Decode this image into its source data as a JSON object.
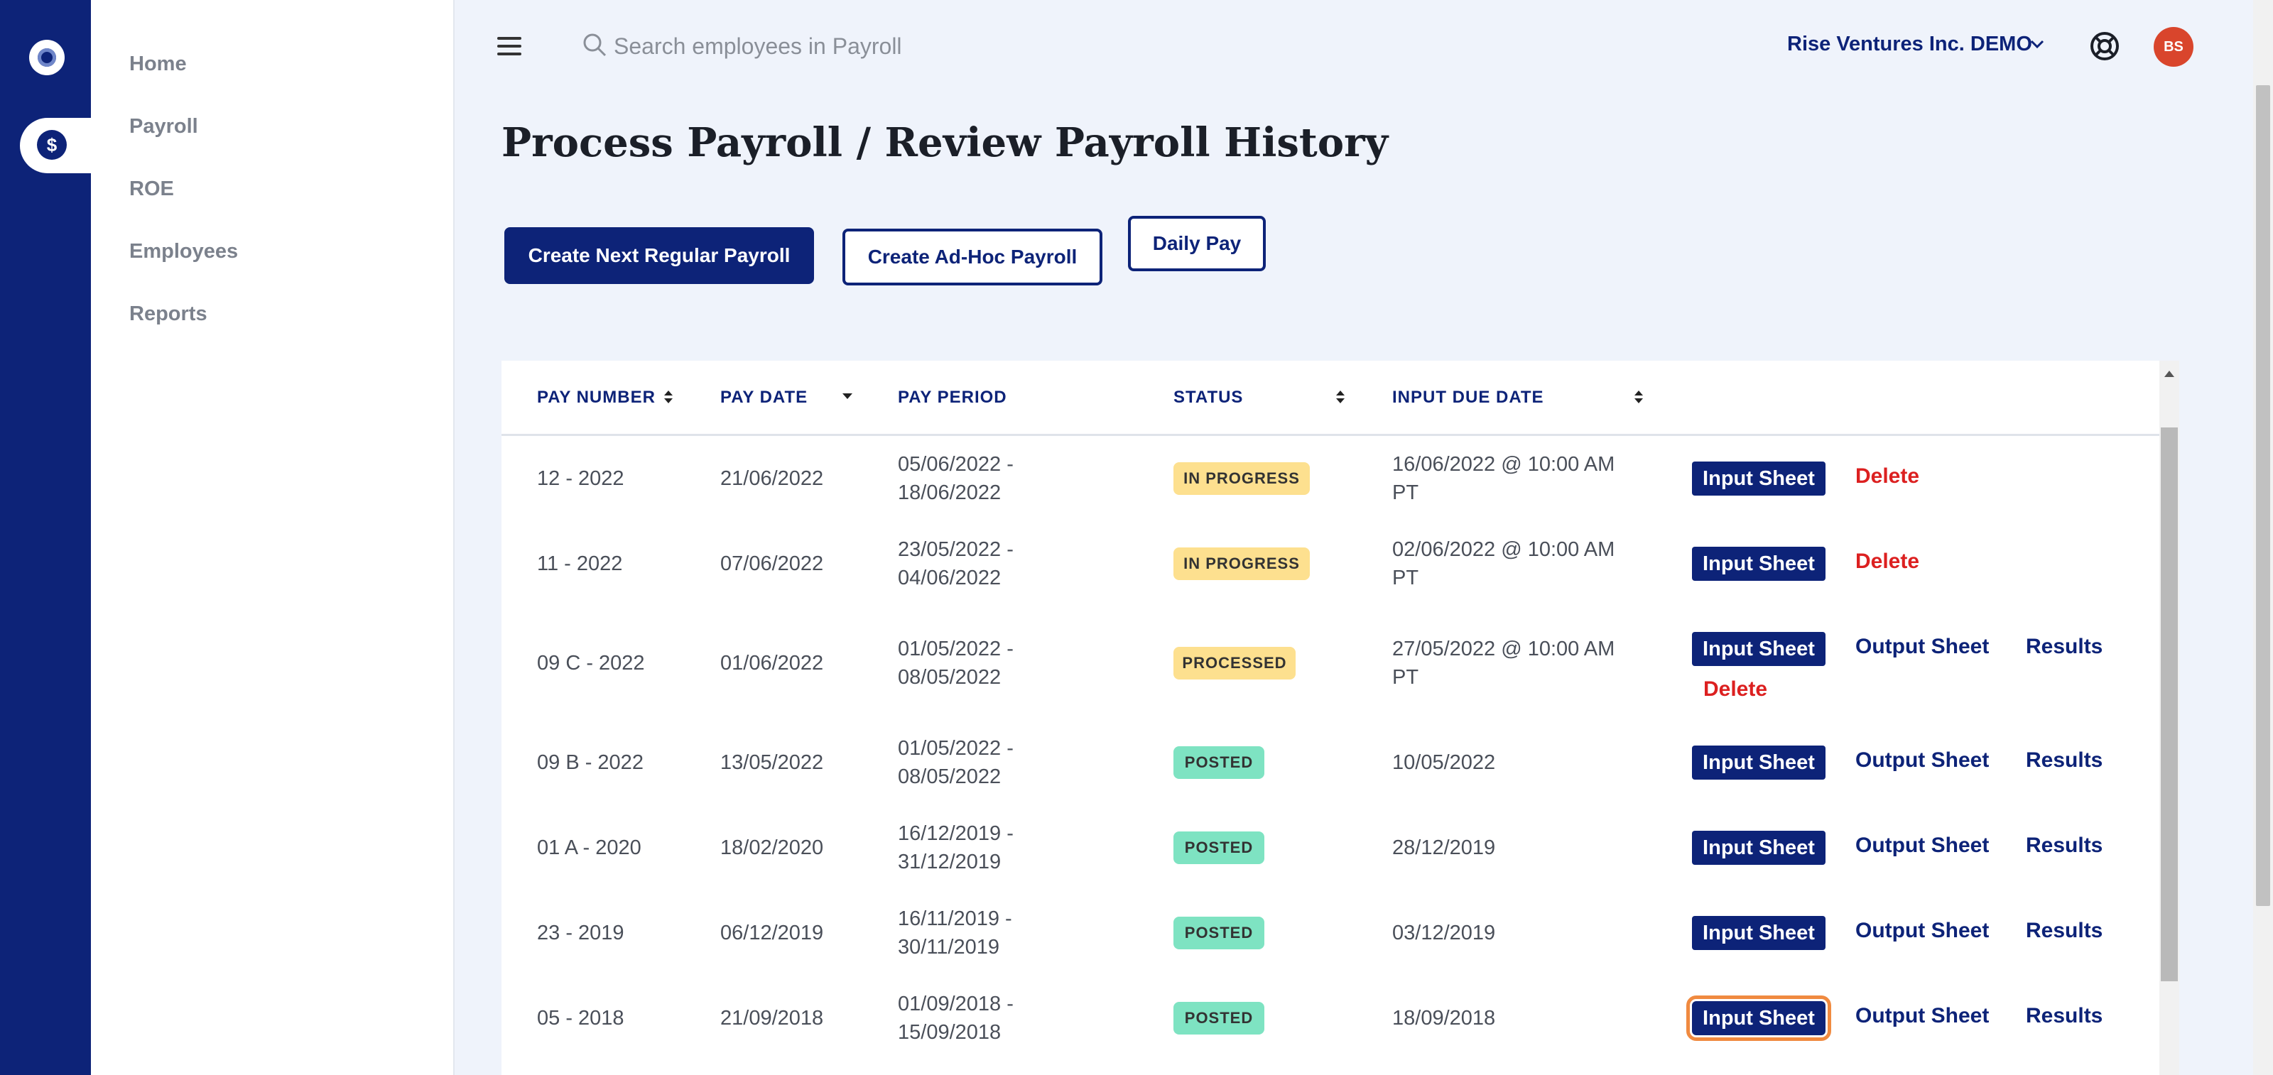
{
  "sidebar": {
    "items": [
      {
        "label": "Home"
      },
      {
        "label": "Payroll"
      },
      {
        "label": "ROE"
      },
      {
        "label": "Employees"
      },
      {
        "label": "Reports"
      }
    ]
  },
  "topbar": {
    "search_placeholder": "Search employees in Payroll",
    "company": "Rise Ventures Inc. DEMO",
    "avatar_initials": "BS"
  },
  "page": {
    "title": "Process Payroll / Review Payroll History",
    "buttons": {
      "create_regular": "Create Next Regular Payroll",
      "create_adhoc": "Create Ad-Hoc Payroll",
      "daily_pay": "Daily Pay"
    }
  },
  "table": {
    "headers": {
      "pay_number": "PAY NUMBER",
      "pay_date": "PAY DATE",
      "pay_period": "PAY PERIOD",
      "status": "STATUS",
      "input_due_date": "INPUT DUE DATE"
    },
    "actions": {
      "input_sheet": "Input Sheet",
      "output_sheet": "Output Sheet",
      "results": "Results",
      "delete": "Delete"
    },
    "rows": [
      {
        "pay_number": "12 - 2022",
        "pay_date": "21/06/2022",
        "period_start": "05/06/2022 -",
        "period_end": "18/06/2022",
        "status": "IN PROGRESS",
        "due_1": "16/06/2022 @ 10:00 AM",
        "due_2": "PT"
      },
      {
        "pay_number": "11 - 2022",
        "pay_date": "07/06/2022",
        "period_start": "23/05/2022 -",
        "period_end": "04/06/2022",
        "status": "IN PROGRESS",
        "due_1": "02/06/2022 @ 10:00 AM",
        "due_2": "PT"
      },
      {
        "pay_number": "09 C - 2022",
        "pay_date": "01/06/2022",
        "period_start": "01/05/2022 -",
        "period_end": "08/05/2022",
        "status": "PROCESSED",
        "due_1": "27/05/2022 @ 10:00 AM",
        "due_2": "PT"
      },
      {
        "pay_number": "09 B - 2022",
        "pay_date": "13/05/2022",
        "period_start": "01/05/2022 -",
        "period_end": "08/05/2022",
        "status": "POSTED",
        "due_1": "10/05/2022",
        "due_2": ""
      },
      {
        "pay_number": "01 A - 2020",
        "pay_date": "18/02/2020",
        "period_start": "16/12/2019 -",
        "period_end": "31/12/2019",
        "status": "POSTED",
        "due_1": "28/12/2019",
        "due_2": ""
      },
      {
        "pay_number": "23 - 2019",
        "pay_date": "06/12/2019",
        "period_start": "16/11/2019 -",
        "period_end": "30/11/2019",
        "status": "POSTED",
        "due_1": "03/12/2019",
        "due_2": ""
      },
      {
        "pay_number": "05 - 2018",
        "pay_date": "21/09/2018",
        "period_start": "01/09/2018 -",
        "period_end": "15/09/2018",
        "status": "POSTED",
        "due_1": "18/09/2018",
        "due_2": ""
      }
    ]
  },
  "colors": {
    "brand_navy": "#0d2378",
    "in_progress": "#fde08f",
    "posted": "#7ee3c2",
    "delete_red": "#dc2020",
    "focus_ring": "#f08a40"
  },
  "icons": [
    "target-logo-icon",
    "dollar-icon",
    "hamburger-icon",
    "search-icon",
    "chevron-down-icon",
    "lifebuoy-icon",
    "sort-icon"
  ]
}
